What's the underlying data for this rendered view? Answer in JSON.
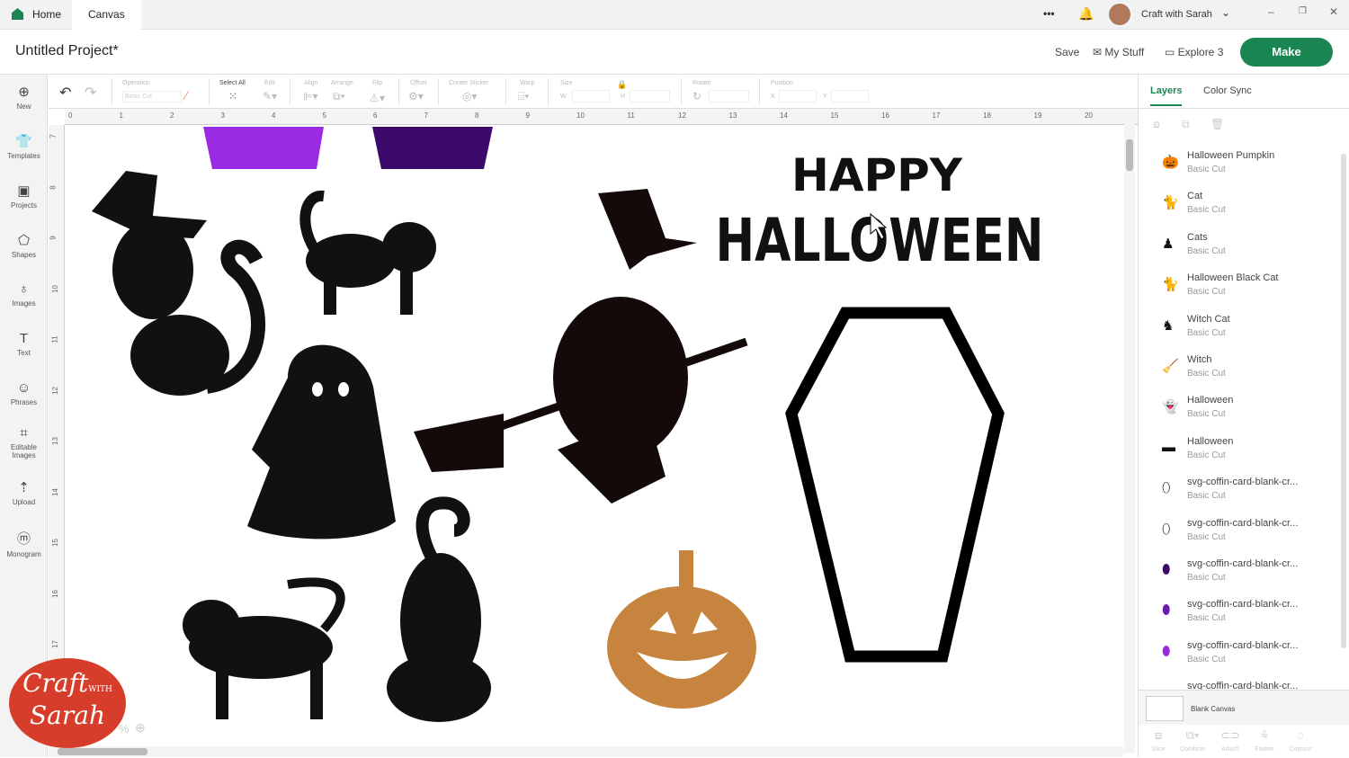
{
  "topbar": {
    "home": "Home",
    "canvas": "Canvas",
    "more": "•••",
    "user": "Craft with Sarah"
  },
  "header": {
    "title": "Untitled Project*",
    "save": "Save",
    "my_stuff": "My Stuff",
    "explore": "Explore 3",
    "make": "Make"
  },
  "sidebar": [
    {
      "icon": "⊕",
      "label": "New"
    },
    {
      "icon": "👕",
      "label": "Templates"
    },
    {
      "icon": "▣",
      "label": "Projects"
    },
    {
      "icon": "⬠",
      "label": "Shapes"
    },
    {
      "icon": "♁",
      "label": "Images"
    },
    {
      "icon": "T",
      "label": "Text"
    },
    {
      "icon": "☺",
      "label": "Phrases"
    },
    {
      "icon": "⌗",
      "label": "Editable Images"
    },
    {
      "icon": "⇡",
      "label": "Upload"
    },
    {
      "icon": "ⓜ",
      "label": "Monogram"
    }
  ],
  "toolbar": {
    "operation": "Operation",
    "operation_value": "Basic Cut",
    "select_all": "Select All",
    "edit": "Edit",
    "align": "Align",
    "arrange": "Arrange",
    "flip": "Flip",
    "offset": "Offset",
    "create_sticker": "Create Sticker",
    "warp": "Warp",
    "size": "Size",
    "w": "W",
    "h": "H",
    "rotate": "Rotate",
    "position": "Position",
    "x": "X",
    "y": "Y"
  },
  "rulers": {
    "h": [
      "0",
      "1",
      "2",
      "3",
      "4",
      "5",
      "6",
      "7",
      "8",
      "9",
      "10",
      "11",
      "12",
      "13",
      "14",
      "15",
      "16",
      "17",
      "18",
      "19",
      "20"
    ],
    "v": [
      "7",
      "8",
      "9",
      "10",
      "11",
      "12",
      "13",
      "14",
      "15",
      "16",
      "17"
    ]
  },
  "canvas": {
    "text_line1": "HAPPY",
    "text_line2": "HALLOWEEN",
    "zoom": "%",
    "colors": {
      "purple": "#9a2be2",
      "dark_purple": "#3b0a6b",
      "pumpkin": "#c7843f",
      "black": "#111111"
    }
  },
  "logo": {
    "line1": "Craft",
    "with": "WITH",
    "line2": "Sarah"
  },
  "panel": {
    "tabs": [
      "Layers",
      "Color Sync"
    ],
    "layers": [
      {
        "name": "Halloween Pumpkin",
        "type": "Basic Cut",
        "icon": "🎃"
      },
      {
        "name": "Cat",
        "type": "Basic Cut",
        "icon": "🐈"
      },
      {
        "name": "Cats",
        "type": "Basic Cut",
        "icon": "♟"
      },
      {
        "name": "Halloween Black Cat",
        "type": "Basic Cut",
        "icon": "🐈"
      },
      {
        "name": "Witch Cat",
        "type": "Basic Cut",
        "icon": "♞"
      },
      {
        "name": "Witch",
        "type": "Basic Cut",
        "icon": "🧹"
      },
      {
        "name": "Halloween",
        "type": "Basic Cut",
        "icon": "👻"
      },
      {
        "name": "Halloween",
        "type": "Basic Cut",
        "icon": "▬"
      },
      {
        "name": "svg-coffin-card-blank-cr...",
        "type": "Basic Cut",
        "icon": "⬯"
      },
      {
        "name": "svg-coffin-card-blank-cr...",
        "type": "Basic Cut",
        "icon": "⬯"
      },
      {
        "name": "svg-coffin-card-blank-cr...",
        "type": "Basic Cut",
        "icon": "⬮"
      },
      {
        "name": "svg-coffin-card-blank-cr...",
        "type": "Basic Cut",
        "icon": "⬮"
      },
      {
        "name": "svg-coffin-card-blank-cr...",
        "type": "Basic Cut",
        "icon": "⬮"
      },
      {
        "name": "svg-coffin-card-blank-cr...",
        "type": "",
        "icon": "▬"
      }
    ],
    "blank_canvas": "Blank Canvas",
    "actions": [
      "Slice",
      "Combine",
      "Attach",
      "Flatten",
      "Contour"
    ]
  }
}
